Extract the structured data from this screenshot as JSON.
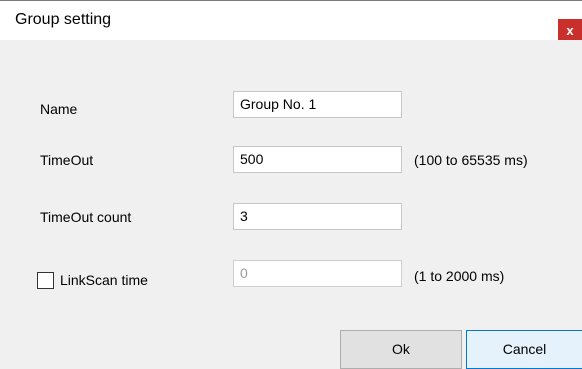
{
  "window": {
    "title": "Group setting",
    "close_label": "x"
  },
  "form": {
    "name": {
      "label": "Name",
      "value": "Group No. 1"
    },
    "timeout": {
      "label": "TimeOut",
      "value": "500",
      "range": "(100 to 65535 ms)"
    },
    "timeout_count": {
      "label": "TimeOut count",
      "value": "3"
    },
    "linkscan": {
      "label": "LinkScan time",
      "checked": false,
      "value": "0",
      "range": "(1 to 2000 ms)"
    }
  },
  "buttons": {
    "ok": "Ok",
    "cancel": "Cancel"
  },
  "colors": {
    "close_bg": "#c9302c",
    "cancel_border": "#0078d7",
    "body_bg": "#f0f0f0"
  }
}
